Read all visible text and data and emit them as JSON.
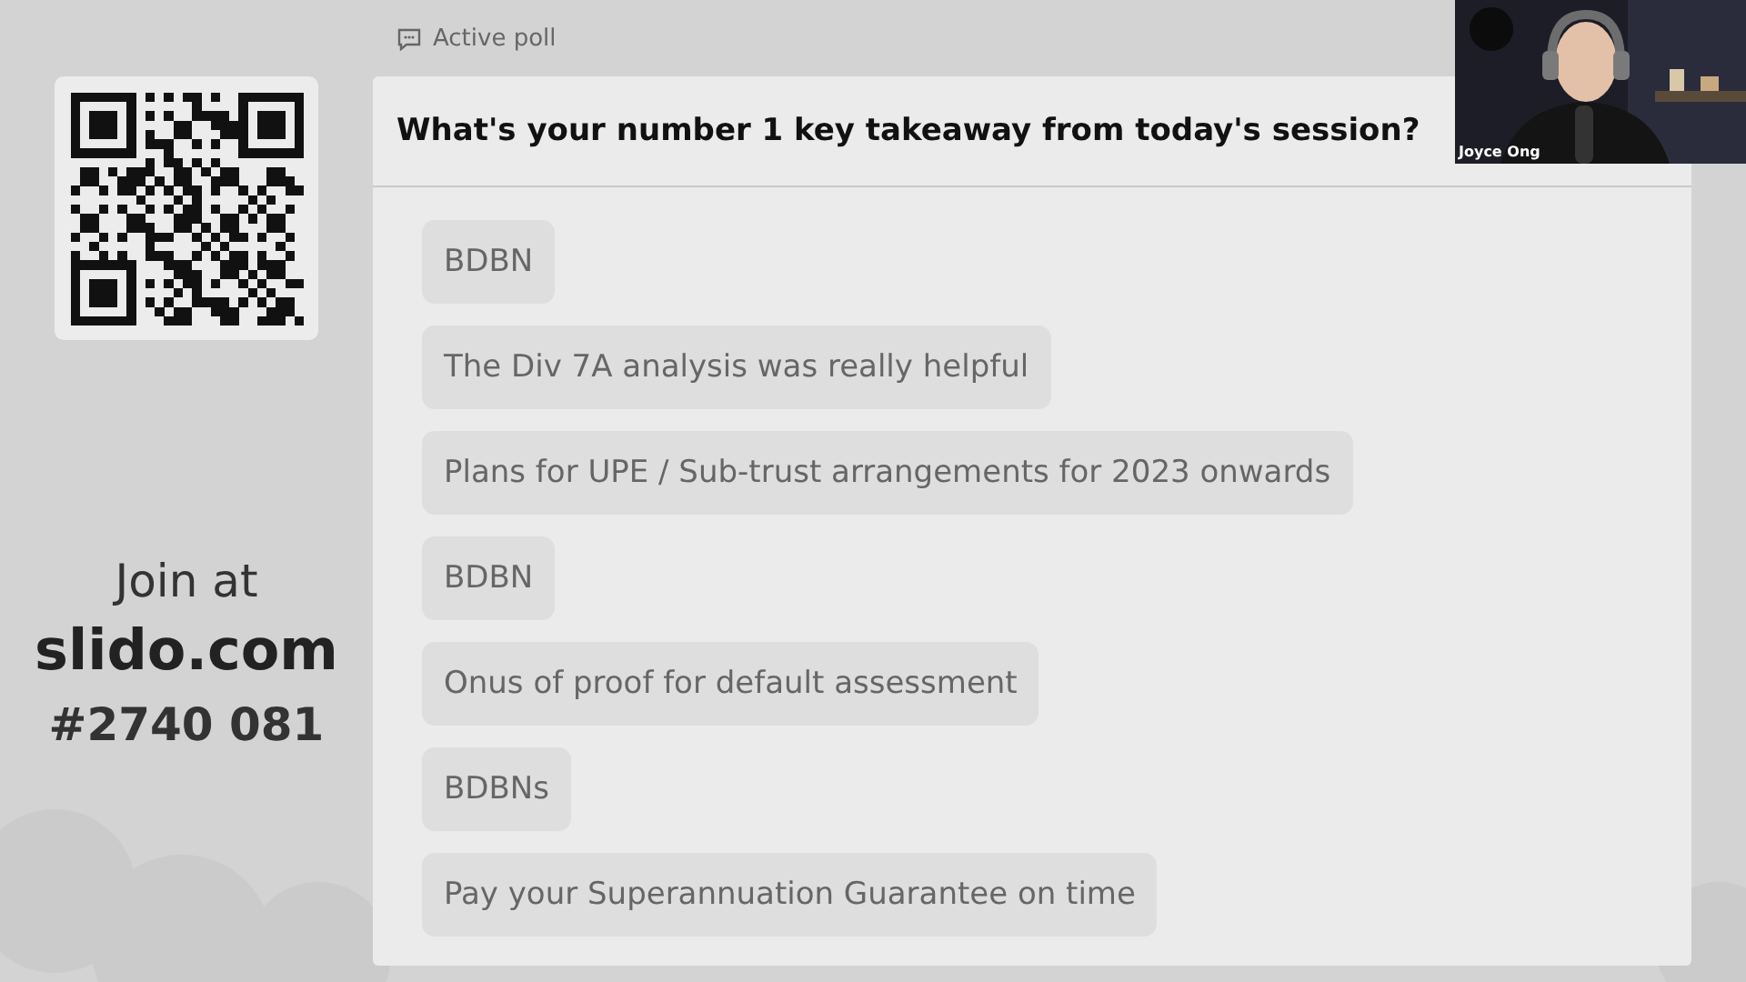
{
  "header": {
    "label": "Active poll"
  },
  "join": {
    "line1": "Join at",
    "site": "slido.com",
    "code": "#2740 081"
  },
  "poll": {
    "question": "What's your number 1 key takeaway from today's session?",
    "answers": [
      "BDBN",
      "The Div 7A analysis was really helpful",
      "Plans for UPE / Sub-trust arrangements for 2023 onwards",
      "BDBN",
      "Onus of proof for default assessment",
      "BDBNs",
      "Pay your Superannuation Guarantee on time"
    ]
  },
  "video": {
    "speaker": "Joyce Ong"
  }
}
